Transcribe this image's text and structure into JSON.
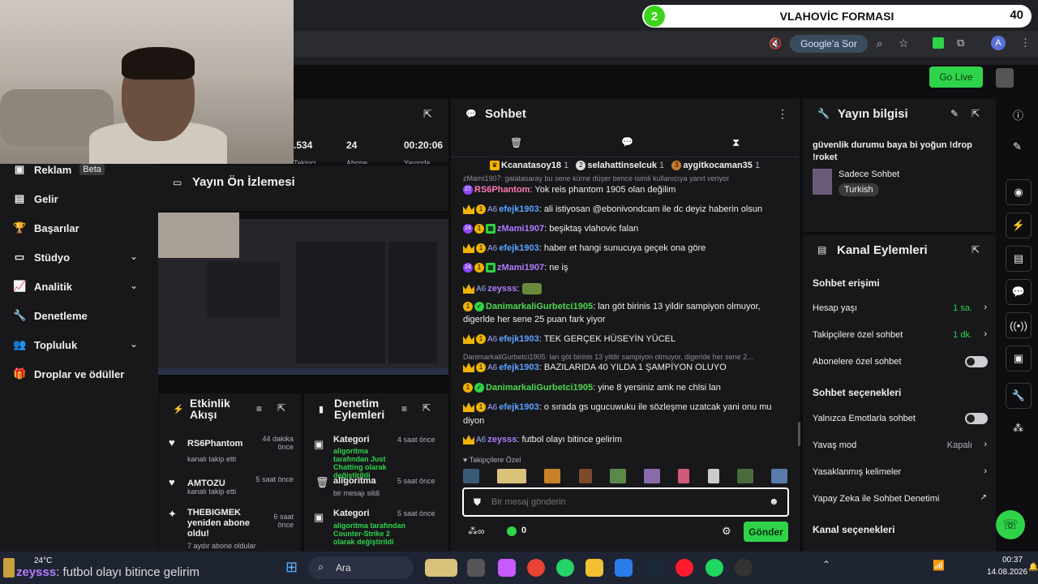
{
  "browser": {
    "tab_number": "2",
    "tab_title": "VLAHOVİC FORMASI",
    "tab_count": "40",
    "google_sor": "Google'a Sor",
    "profile_initial": "A"
  },
  "header": {
    "go_live": "Go Live"
  },
  "nav": {
    "items": [
      {
        "label": "Reklam",
        "badge": "Beta"
      },
      {
        "label": "Gelir"
      },
      {
        "label": "Başarılar"
      },
      {
        "label": "Stüdyo"
      },
      {
        "label": "Analitik"
      },
      {
        "label": "Denetleme"
      },
      {
        "label": "Topluluk"
      },
      {
        "label": "Droplar ve ödüller"
      }
    ]
  },
  "stats": {
    "viewers": ".534",
    "subscribers": "24",
    "uptime": "00:20:06",
    "viewers_label": "Takipçi",
    "subs_label": "Abone",
    "uptime_label": "Yayında"
  },
  "preview": {
    "title": "Yayın Ön İzlemesi"
  },
  "activity": {
    "title": "Etkinlik Akışı",
    "items": [
      {
        "name": "RS6Phantom",
        "desc": "kanalı takip etti",
        "time": "44 dakika önce"
      },
      {
        "name": "AMTOZU",
        "desc": "kanalı takip etti",
        "time": "5 saat önce"
      },
      {
        "name": "THEBIGMEK yeniden abone oldu!",
        "desc": "7 aydır abone oldular",
        "time": "6 saat önce"
      }
    ]
  },
  "moderation": {
    "title": "Denetim Eylemleri",
    "items": [
      {
        "name": "Kategori",
        "line1": "aligoritma tarafından Just Chatting olarak değiştirildi",
        "time": "4 saat önce"
      },
      {
        "name": "aligoritma",
        "line1": "bir mesajı sildi",
        "time": "5 saat önce"
      },
      {
        "name": "Kategori",
        "line1": "aligoritma tarafından Counter-Strike 2 olarak değiştirildi",
        "time": "5 saat önce"
      }
    ]
  },
  "chat": {
    "title": "Sohbet",
    "leaderboard": [
      {
        "rank": "1",
        "name": "Kcanatasoy18",
        "count": "1"
      },
      {
        "rank": "2",
        "name": "selahattinselcuk",
        "count": "1"
      },
      {
        "rank": "3",
        "name": "aygitkocaman35",
        "count": "1"
      }
    ],
    "reply_top": "zMami1907: galatasaray bu sene küme düşer bence isimli kullanıcıya yanıt veriyor",
    "messages": [
      {
        "user": "RS6Phantom",
        "text": ": Yok reis phantom 1905 olan değilim"
      },
      {
        "user": "efejk1903",
        "text": ": ali istiyosan @ebonivondcam ile dc deyiz haberin olsun"
      },
      {
        "user": "zMami1907",
        "text": ": beşiktaş vlahovic falan"
      },
      {
        "user": "efejk1903",
        "text": ": haber et hangi sunucuya geçek ona göre"
      },
      {
        "user": "zMami1907",
        "text": ": ne iş"
      },
      {
        "user": "zeysss",
        "text": ":"
      },
      {
        "user": "DanimarkaliGurbetci1905",
        "text": ": lan göt birinis 13 yildir sampiyon olmuyor, digerlde her sene 25 puan fark yiyor"
      },
      {
        "user": "efejk1903",
        "text": ": TEK GERÇEK HÜSEYİN YÜCEL"
      },
      {
        "user": "efejk1903",
        "text": ": BAZILARIDA 40 YILDA 1 ŞAMPİYON OLUYO"
      },
      {
        "user": "DanimarkaliGurbetci1905",
        "text": ": yine 8 yersiniz amk ne chlsi lan"
      },
      {
        "user": "efejk1903",
        "text": ": o sırada gs ugucuwuku ile sözleşme uzatcak yani onu mu diyon"
      },
      {
        "user": "zeysss",
        "text": ": futbol olayı bitince gelirim"
      }
    ],
    "reply_mid": "DanimarkaliGurbetci1905: lan göt birinis 13 yildir sampiyon olmuyor, digerlde her sene 2...",
    "emote_label": "Takipçilere Özel",
    "input_placeholder": "Bir mesaj gönderin",
    "points": "0",
    "send": "Gönder"
  },
  "stream_info": {
    "title": "Yayın bilgisi",
    "stream_title": "güvenlik durumu baya bi yoğun !drop !roket",
    "category": "Sadece Sohbet",
    "tag": "Turkish"
  },
  "channel_actions": {
    "title": "Kanal Eylemleri",
    "chat_access": "Sohbet erişimi",
    "account_age": "Hesap yaşı",
    "account_age_val": "1 sa.",
    "followers_only": "Takipçilere özel sohbet",
    "followers_only_val": "1 dk.",
    "subs_only": "Abonelere özel sohbet",
    "chat_options": "Sohbet seçenekleri",
    "emote_only": "Yalnızca Emotlarla sohbet",
    "slow_mode": "Yavaş mod",
    "slow_mode_val": "Kapalı",
    "banned_words": "Yasaklanmış kelimeler",
    "ai_mod": "Yapay Zeka ile Sohbet Denetimi",
    "channel_options": "Kanal seçenekleri"
  },
  "taskbar": {
    "weather": "24°C",
    "overlay_user": "zeysss",
    "overlay_text": ": futbol olayı bitince gelirim",
    "search": "Ara",
    "time": "00:37",
    "date": "14.08.2026"
  },
  "colors": {
    "accent": "#2fd34a",
    "bg": "#0e0e10",
    "panel": "#18181b"
  }
}
